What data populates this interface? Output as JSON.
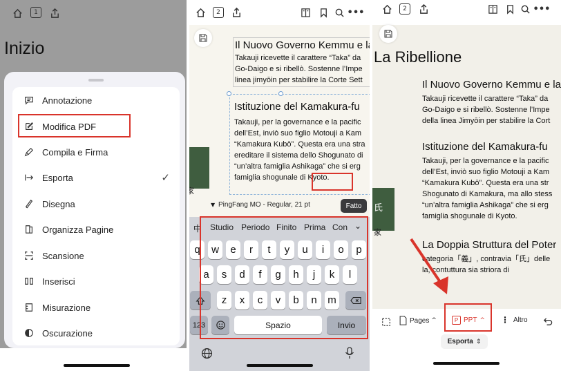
{
  "panel1": {
    "toolbar": {
      "page_number": "1"
    },
    "title": "Inizio",
    "menu": [
      {
        "label": "Annotazione",
        "icon": "comment-icon"
      },
      {
        "label": "Modifica PDF",
        "icon": "edit-icon"
      },
      {
        "label": "Compila e Firma",
        "icon": "pen-icon"
      },
      {
        "label": "Esporta",
        "icon": "export-icon",
        "checked": true
      },
      {
        "label": "Disegna",
        "icon": "pencil-icon"
      },
      {
        "label": "Organizza Pagine",
        "icon": "pages-icon"
      },
      {
        "label": "Scansione",
        "icon": "scan-icon"
      },
      {
        "label": "Inserisci",
        "icon": "insert-icon"
      },
      {
        "label": "Misurazione",
        "icon": "ruler-icon"
      },
      {
        "label": "Oscurazione",
        "icon": "redact-icon"
      }
    ]
  },
  "panel2": {
    "toolbar": {
      "page_number": "2"
    },
    "block1": {
      "heading": "Il Nuovo Governo Kemmu e la",
      "lines": [
        "Takauji ricevette il carattere “Taka” da",
        "Go-Daigo e si ribellò. Sostenne l’Impe",
        "linea jimyōin per stabilire la Corte Sett"
      ]
    },
    "block2": {
      "heading": "Istituzione del Kamakura-fu",
      "lines": [
        "Takauji, per la governance e la pacific",
        "dell’Est, inviò suo figlio Motouji a Kam",
        "“Kamakura Kubō”. Questa era una stra",
        "ereditare il sistema dello Shogunato di",
        "“un’altra famiglia Ashikaga” che si erg",
        "famiglia shogunale di Kyoto."
      ]
    },
    "side_char": "家",
    "font_label": "PingFang MO - Regular, 21 pt",
    "done_label": "Fatto",
    "suggestions": [
      "中",
      "Studio",
      "Periodo",
      "Finito",
      "Prima",
      "Con"
    ],
    "keys_row1": [
      "q",
      "w",
      "e",
      "r",
      "t",
      "y",
      "u",
      "i",
      "o",
      "p"
    ],
    "keys_row2": [
      "a",
      "s",
      "d",
      "f",
      "g",
      "h",
      "j",
      "k",
      "l"
    ],
    "keys_row3": [
      "z",
      "x",
      "c",
      "v",
      "b",
      "n",
      "m"
    ],
    "key_123": "123",
    "key_space": "Spazio",
    "key_return": "Invio"
  },
  "panel3": {
    "toolbar": {
      "page_number": "2"
    },
    "title": "La Ribellione",
    "block1": {
      "heading": "Il Nuovo Governo Kemmu e la",
      "lines": [
        "Takauji ricevette il carattere “Taka” da",
        "Go-Daigo e si ribellò. Sostenne l’Impe",
        "della linea Jimyōin per stabilire la Cort"
      ]
    },
    "block2": {
      "heading": "Istituzione del Kamakura-fu",
      "lines": [
        "Takauji, per la governance e la pacific",
        "dell’Est, inviò suo figlio Motouji a Kam",
        "“Kamakura Kubō”. Questa era una str",
        "Shogunato di Kamakura, ma allo stess",
        "“un’altra famiglia Ashikaga” che si erg",
        "famiglia shogunale di Kyoto."
      ]
    },
    "block3": {
      "heading": "La Doppia Struttura del Poter",
      "lines": [
        "categoria「義」, contravia「氏」delle",
        "la, contuttura sia striora di"
      ]
    },
    "side_chars": [
      "氏",
      "家"
    ],
    "bottom": {
      "pages": "Pages",
      "ppt": "PPT",
      "altro": "Altro",
      "esporta": "Esporta"
    }
  },
  "colors": {
    "highlight": "#d9342b",
    "arrow": "#d9342b"
  }
}
